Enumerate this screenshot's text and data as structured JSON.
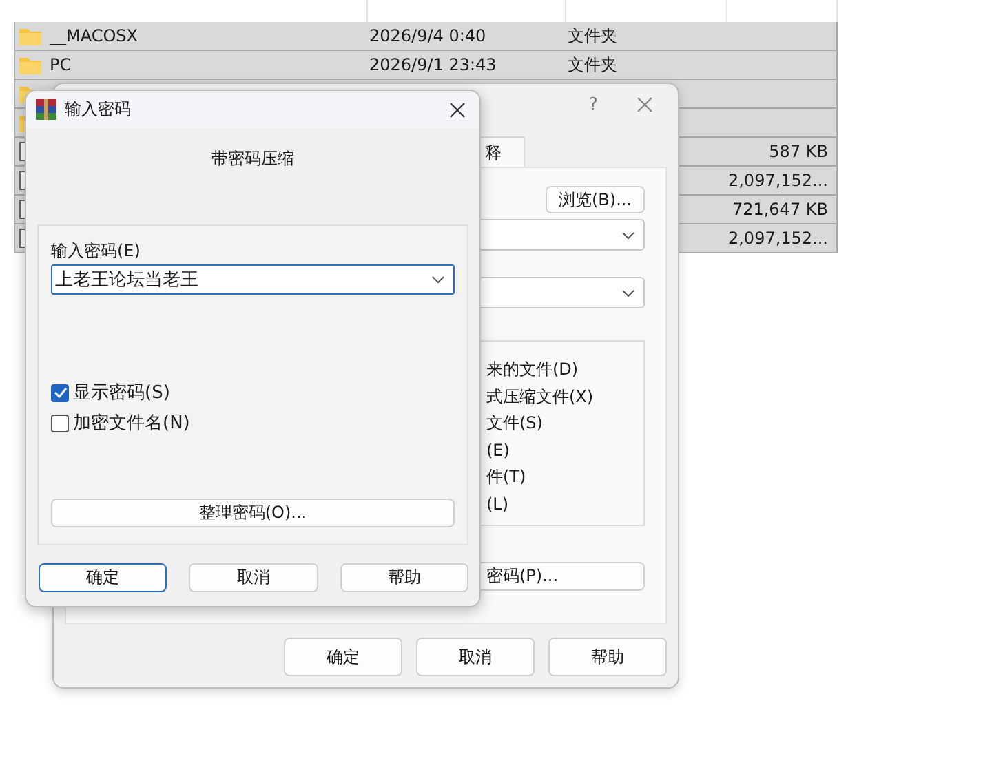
{
  "file_list": {
    "rows": [
      {
        "kind": "folder",
        "name": "__MACOSX",
        "modified": "2026/9/4 0:40",
        "type": "文件夹",
        "selected": true
      },
      {
        "kind": "folder",
        "name": "PC",
        "modified": "2026/9/1 23:43",
        "type": "文件夹",
        "selected": true
      },
      {
        "kind": "folder",
        "selected": true
      },
      {
        "kind": "folder",
        "selected": true
      },
      {
        "kind": "file",
        "size": "587 KB",
        "selected": true
      },
      {
        "kind": "file",
        "size": "2,097,152...",
        "selected": true
      },
      {
        "kind": "file",
        "size": "721,647 KB",
        "selected": true
      },
      {
        "kind": "file",
        "size": "2,097,152...",
        "selected": true
      }
    ]
  },
  "archive_dialog": {
    "help_glyph": "?",
    "tab": {
      "label": "释",
      "selected": true
    },
    "browse_button": "浏览(B)...",
    "options": [
      "来的文件(D)",
      "式压缩文件(X)",
      "文件(S)",
      "(E)",
      "件(T)",
      "(L)"
    ],
    "password_button": "密码(P)...",
    "buttons": [
      "确定",
      "取消",
      "帮助"
    ]
  },
  "password_dialog": {
    "title": "输入密码",
    "heading": "带密码压缩",
    "password_label": "输入密码(E)",
    "password_value": "上老王论坛当老王",
    "checkboxes": [
      {
        "label": "显示密码(S)",
        "checked": true
      },
      {
        "label": "加密文件名(N)",
        "checked": false
      }
    ],
    "manage_button": "整理密码(O)...",
    "buttons": [
      {
        "label": "确定",
        "default": true
      },
      {
        "label": "取消",
        "default": false
      },
      {
        "label": "帮助",
        "default": false
      }
    ]
  }
}
